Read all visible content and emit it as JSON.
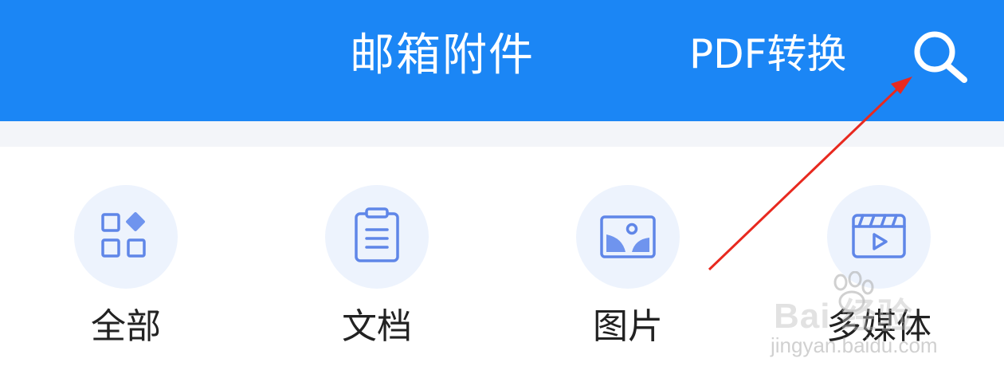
{
  "header": {
    "title": "邮箱附件",
    "pdf_convert_label": "PDF转换",
    "background_color": "#1b86f5",
    "search_icon": "search-icon"
  },
  "categories": [
    {
      "label": "全部",
      "icon": "grid-icon"
    },
    {
      "label": "文档",
      "icon": "clipboard-icon"
    },
    {
      "label": "图片",
      "icon": "image-icon"
    },
    {
      "label": "多媒体",
      "icon": "video-clapper-icon"
    }
  ],
  "colors": {
    "icon_stroke": "#5f86e8",
    "icon_circle": "#edf3fd",
    "annotation_arrow": "#e8291f"
  },
  "watermark": {
    "main": "Bai  经验",
    "sub": "jingyan.baidu.com"
  }
}
